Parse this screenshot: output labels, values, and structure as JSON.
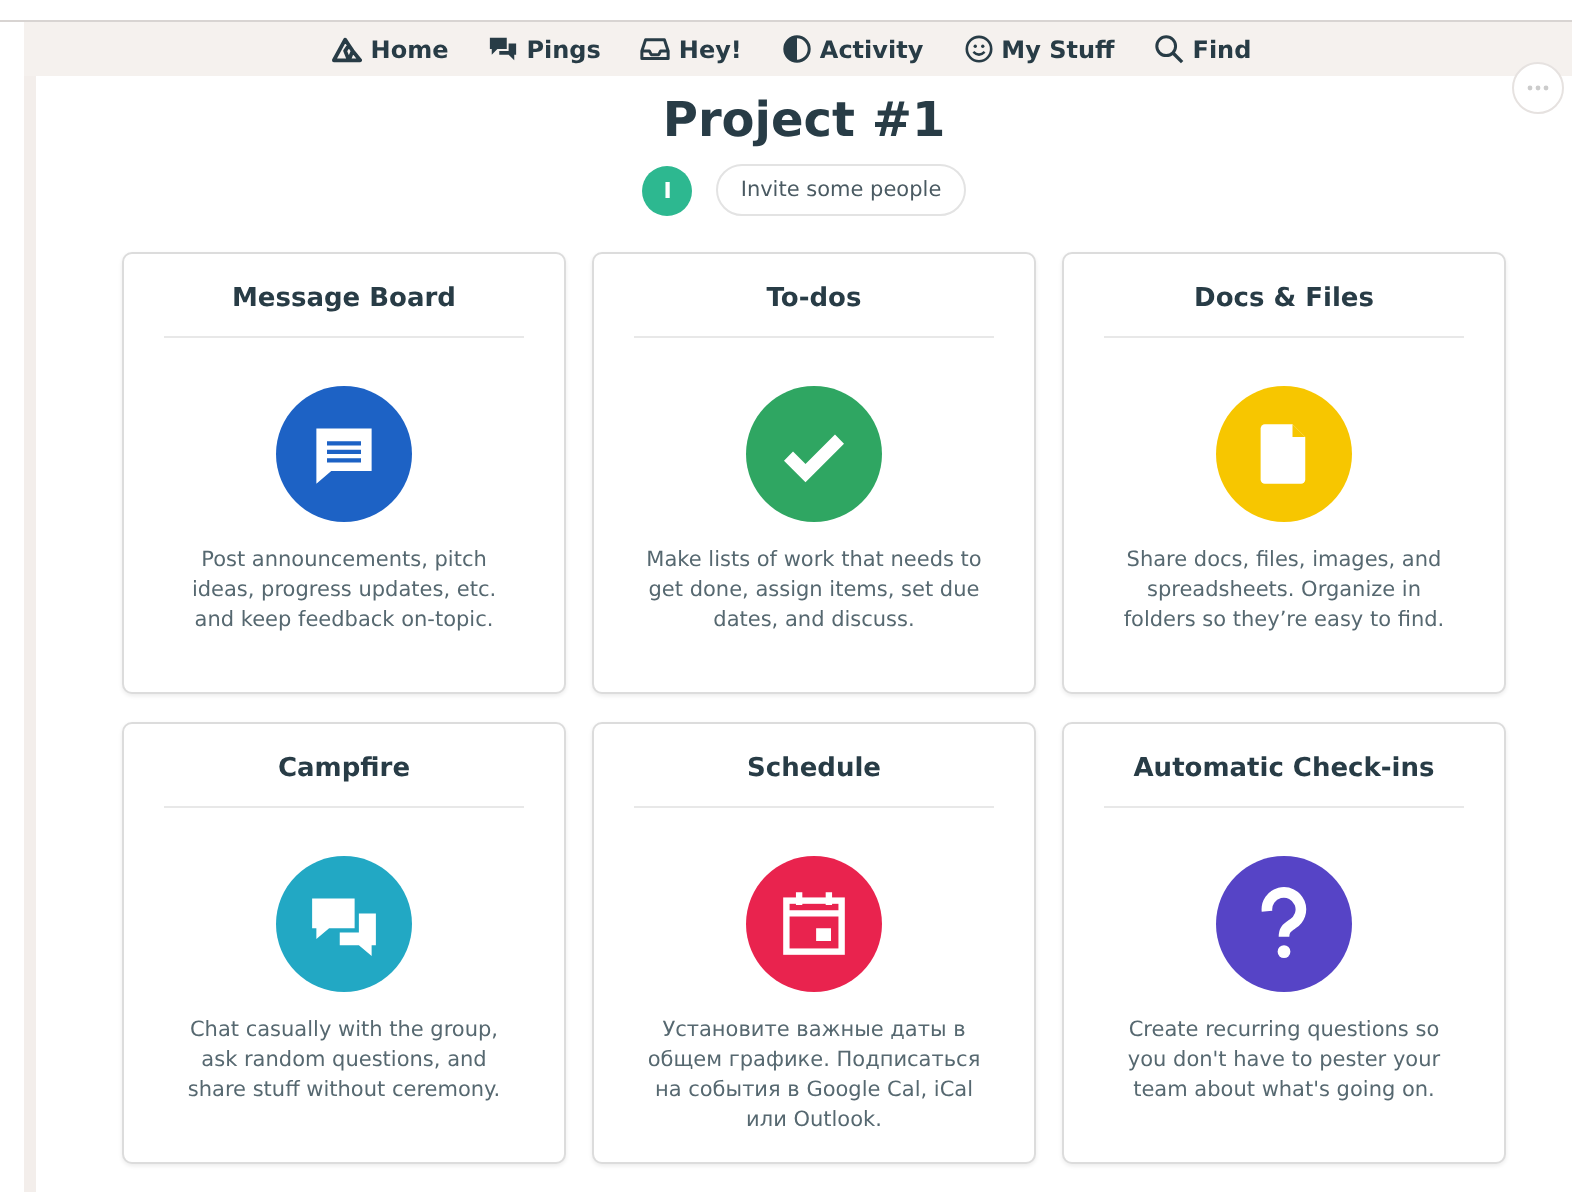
{
  "nav": [
    {
      "label": "Home",
      "kind": "home"
    },
    {
      "label": "Pings",
      "kind": "pings"
    },
    {
      "label": "Hey!",
      "kind": "hey"
    },
    {
      "label": "Activity",
      "kind": "activity"
    },
    {
      "label": "My Stuff",
      "kind": "stuff"
    },
    {
      "label": "Find",
      "kind": "find"
    }
  ],
  "project": {
    "title": "Project #1",
    "avatar": "I",
    "invite": "Invite some people"
  },
  "tools": [
    {
      "title": "Message Board",
      "kind": "message",
      "color": "#1d62c5",
      "description": "Post announcements, pitch ideas, progress updates, etc. and keep feedback on-topic."
    },
    {
      "title": "To-dos",
      "kind": "check",
      "color": "#2fa662",
      "description": "Make lists of work that needs to get done, assign items, set due dates, and discuss."
    },
    {
      "title": "Docs & Files",
      "kind": "doc",
      "color": "#f7c600",
      "description": "Share docs, files, images, and spreadsheets. Organize in folders so they’re easy to find."
    },
    {
      "title": "Campfire",
      "kind": "chat",
      "color": "#22a8c4",
      "description": "Chat casually with the group, ask random questions, and share stuff without ceremony."
    },
    {
      "title": "Schedule",
      "kind": "calendar",
      "color": "#e9234e",
      "description": "Установите важные даты в общем графике. Подписаться на события в Google Cal, iCal или Outlook."
    },
    {
      "title": "Automatic Check-ins",
      "kind": "question",
      "color": "#5644c6",
      "description": "Create recurring questions so you don't have to pester your team about what's going on."
    }
  ]
}
